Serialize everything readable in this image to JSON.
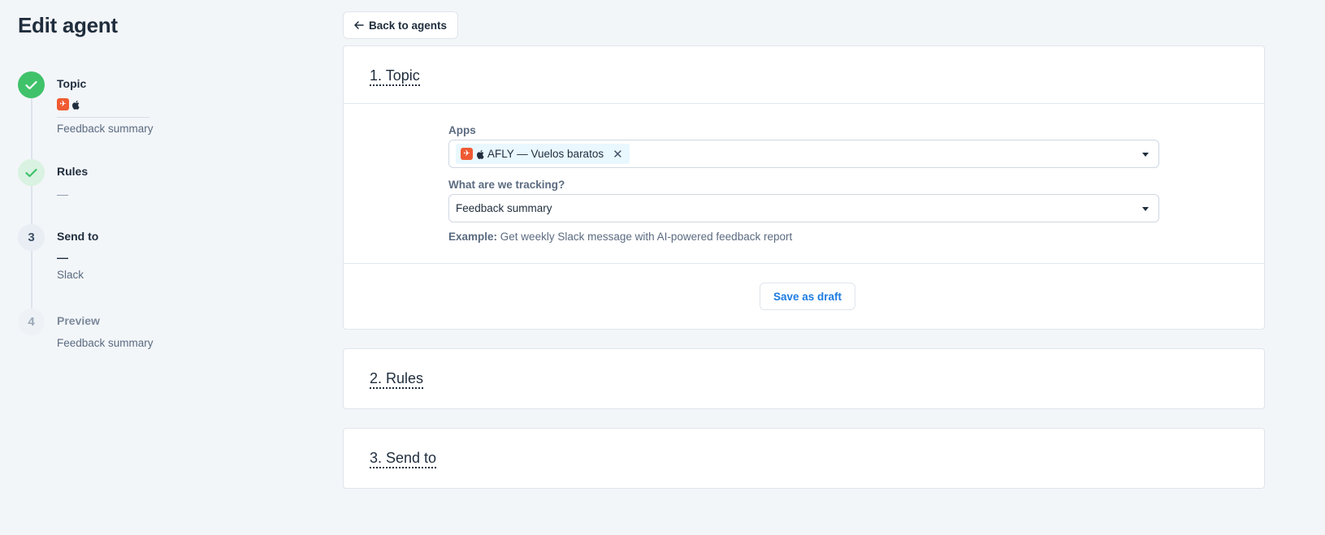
{
  "page": {
    "title": "Edit agent"
  },
  "stepper": {
    "steps": [
      {
        "marker": "",
        "title": "Topic",
        "sub": "Feedback summary",
        "state": "done"
      },
      {
        "marker": "",
        "title": "Rules",
        "sub": "—",
        "state": "done-light"
      },
      {
        "marker": "3",
        "title": "Send to",
        "dash": "—",
        "sub": "Slack",
        "state": "pending"
      },
      {
        "marker": "4",
        "title": "Preview",
        "sub": "Feedback summary",
        "state": "inactive"
      }
    ]
  },
  "nav": {
    "back_label": "Back to agents"
  },
  "topic_card": {
    "title": "1. Topic",
    "apps_label": "Apps",
    "app_chip": "AFLY — Vuelos baratos",
    "tracking_label": "What are we tracking?",
    "tracking_value": "Feedback summary",
    "example_prefix": "Example:",
    "example_text": "Get weekly Slack message with AI-powered feedback report",
    "save_draft_label": "Save as draft"
  },
  "rules_card": {
    "title": "2. Rules"
  },
  "send_card": {
    "title": "3. Send to"
  },
  "icons": {
    "check": "check-icon",
    "app": "plane-app-icon",
    "platform": "apple-icon",
    "back": "arrow-left-icon",
    "remove": "close-icon",
    "dropdown": "caret-down-icon"
  },
  "colors": {
    "accent": "#1c7ce0",
    "success": "#3fc26a",
    "success_light": "#d9f2e1",
    "app_icon": "#ef5a32",
    "chip_bg": "#e9f7ff"
  }
}
